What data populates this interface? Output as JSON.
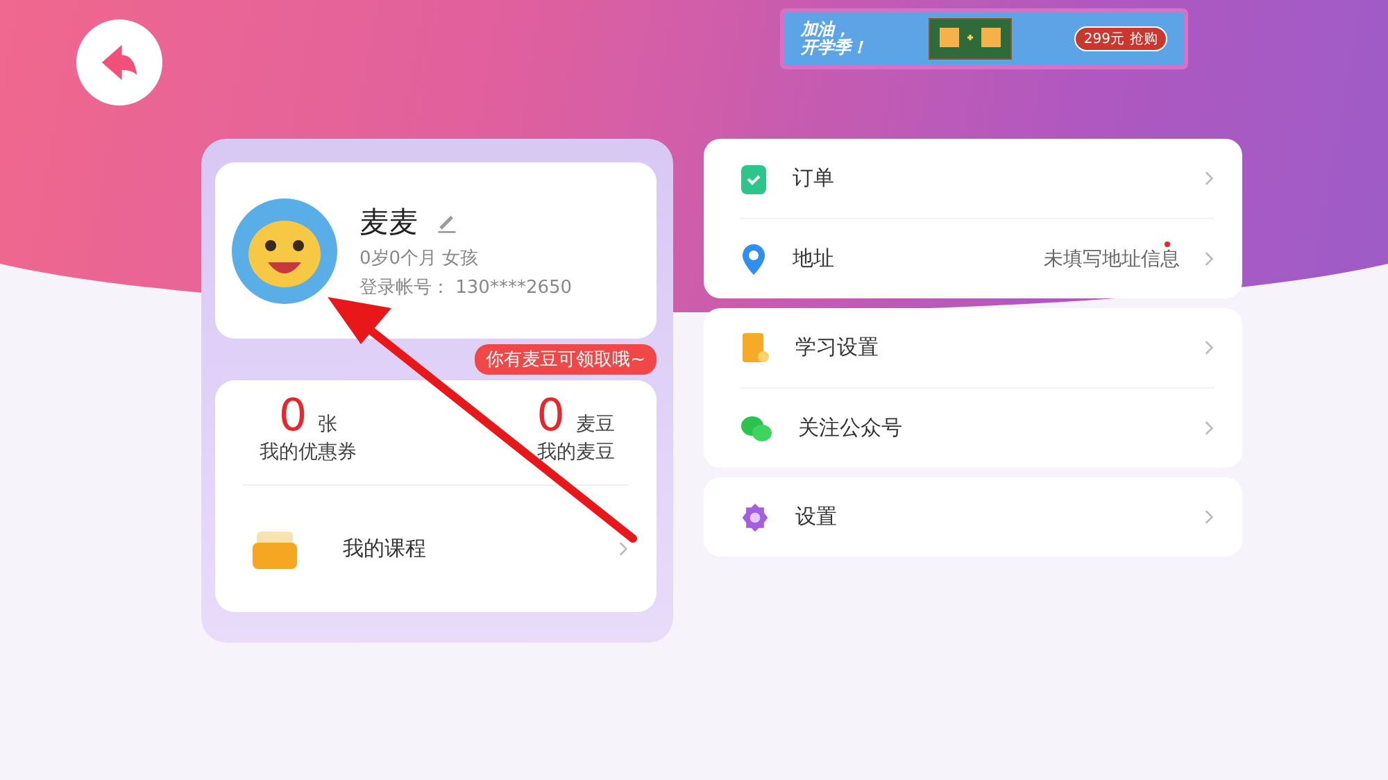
{
  "banner": {
    "headline_1": "加油，",
    "headline_2": "开学季！",
    "price": "299元",
    "action": "抢购"
  },
  "profile": {
    "name": "麦麦",
    "age_gender": "0岁0个月  女孩",
    "account": "登录帐号：  130****2650"
  },
  "tooltip": "你有麦豆可领取哦~",
  "stats": [
    {
      "value": "0",
      "unit": "张",
      "label": "我的优惠券"
    },
    {
      "value": "0",
      "unit": "麦豆",
      "label": "我的麦豆"
    }
  ],
  "course": {
    "label": "我的课程"
  },
  "menu_groups": [
    [
      {
        "kind": "order",
        "label": "订单",
        "dot": false
      },
      {
        "kind": "address",
        "label": "地址",
        "value_text": "未填写地址信息",
        "dot": true
      }
    ],
    [
      {
        "kind": "study",
        "label": "学习设置",
        "dot": false
      },
      {
        "kind": "wechat",
        "label": "关注公众号",
        "dot": false
      }
    ],
    [
      {
        "kind": "settings",
        "label": "设置",
        "dot": false
      }
    ]
  ]
}
